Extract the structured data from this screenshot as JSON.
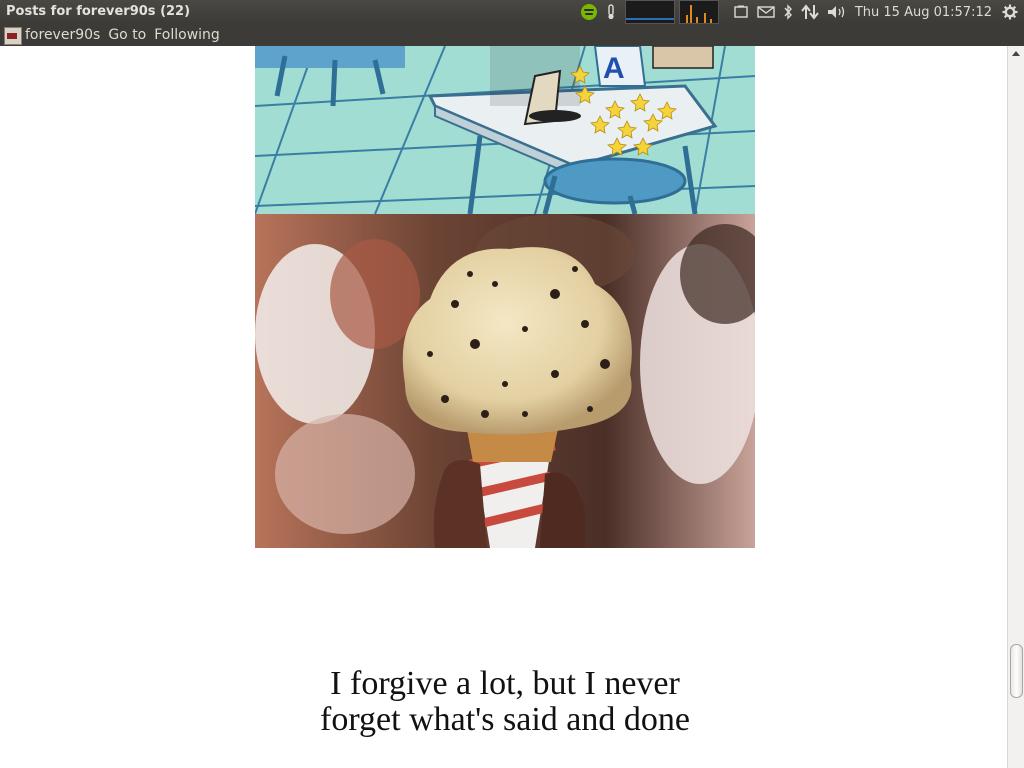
{
  "panel": {
    "window_title": "Posts for forever90s (22)",
    "icons": [
      "spotify-icon",
      "thermometer-icon",
      "cpu-graph",
      "network-graph",
      "battery-icon",
      "mail-icon",
      "bluetooth-icon",
      "network-icon",
      "volume-icon",
      "gear-icon"
    ],
    "clock": "Thu 15 Aug  01:57:12"
  },
  "menu": {
    "app_icon": "tumblr-app-icon",
    "items": [
      "forever90s",
      "Go to",
      "Following"
    ]
  },
  "content": {
    "quote_line1": "I forgive a lot, but I never",
    "quote_line2": "forget what's said and done"
  },
  "colors": {
    "panel_bg": "#3c3b37",
    "panel_text": "#dfdbd2",
    "page_bg": "#ffffff"
  }
}
